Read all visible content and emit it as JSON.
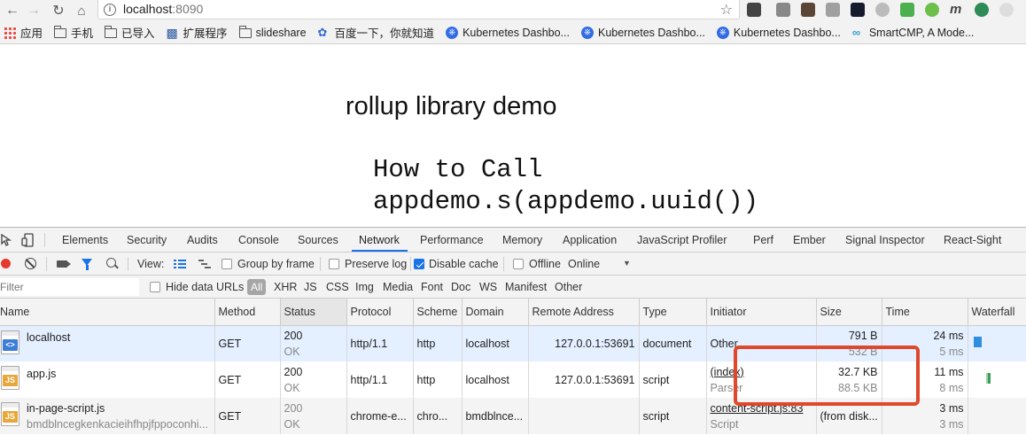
{
  "browser": {
    "url_host": "localhost",
    "url_port": ":8090",
    "bookmarks": [
      {
        "label": "应用",
        "icon": "apps-grid-icon"
      },
      {
        "label": "手机",
        "icon": "folder-icon"
      },
      {
        "label": "已导入",
        "icon": "folder-icon"
      },
      {
        "label": "扩展程序",
        "icon": "puzzle-icon"
      },
      {
        "label": "slideshare",
        "icon": "folder-icon"
      },
      {
        "label": "百度一下，你就知道",
        "icon": "baidu-paw-icon"
      },
      {
        "label": "Kubernetes Dashbo...",
        "icon": "kubernetes-icon"
      },
      {
        "label": "Kubernetes Dashbo...",
        "icon": "kubernetes-icon"
      },
      {
        "label": "Kubernetes Dashbo...",
        "icon": "kubernetes-icon"
      },
      {
        "label": "SmartCMP, A Mode...",
        "icon": "smartcmp-icon"
      }
    ]
  },
  "page": {
    "title": "rollup library demo",
    "code_line1": "How to Call",
    "code_line2": "appdemo.s(appdemo.uuid())"
  },
  "devtools": {
    "tabs": [
      "Elements",
      "Security",
      "Audits",
      "Console",
      "Sources",
      "Network",
      "Performance",
      "Memory",
      "Application",
      "JavaScript Profiler",
      "Perf",
      "Ember",
      "Signal Inspector",
      "React-Sight"
    ],
    "active_tab": "Network",
    "toolbar": {
      "view_label": "View:",
      "group_by_frame": "Group by frame",
      "preserve_log": "Preserve log",
      "disable_cache": "Disable cache",
      "offline": "Offline",
      "throttle": "Online"
    },
    "filter": {
      "placeholder": "Filter",
      "hide_data_urls": "Hide data URLs",
      "types": [
        "All",
        "XHR",
        "JS",
        "CSS",
        "Img",
        "Media",
        "Font",
        "Doc",
        "WS",
        "Manifest",
        "Other"
      ]
    },
    "columns": [
      "Name",
      "Method",
      "Status",
      "Protocol",
      "Scheme",
      "Domain",
      "Remote Address",
      "Type",
      "Initiator",
      "Size",
      "Time",
      "Waterfall"
    ],
    "rows": [
      {
        "name": "localhost",
        "name_sub": "",
        "method": "GET",
        "status": "200",
        "status_text": "OK",
        "protocol": "http/1.1",
        "scheme": "http",
        "domain": "localhost",
        "remote": "127.0.0.1:53691",
        "type": "document",
        "initiator": "Other",
        "initiator_sub": "",
        "size": "791 B",
        "size_sub": "532 B",
        "time": "24 ms",
        "time_sub": "5 ms"
      },
      {
        "name": "app.js",
        "name_sub": "",
        "method": "GET",
        "status": "200",
        "status_text": "OK",
        "protocol": "http/1.1",
        "scheme": "http",
        "domain": "localhost",
        "remote": "127.0.0.1:53691",
        "type": "script",
        "initiator": "(index)",
        "initiator_sub": "Parser",
        "size": "32.7 KB",
        "size_sub": "88.5 KB",
        "time": "11 ms",
        "time_sub": "8 ms"
      },
      {
        "name": "in-page-script.js",
        "name_sub": "bmdblncegkenkacieihfhpjfppoconhi...",
        "method": "GET",
        "status": "200",
        "status_text": "OK",
        "protocol": "chrome-e...",
        "scheme": "chro...",
        "domain": "bmdblnce...",
        "remote": "",
        "type": "script",
        "initiator": "content-script.js:83",
        "initiator_sub": "Script",
        "size": "(from disk...",
        "size_sub": "",
        "time": "3 ms",
        "time_sub": "3 ms"
      }
    ]
  },
  "colors": {
    "accent": "#1a73e8",
    "record": "#e63a2e",
    "annotation": "#e0482c",
    "selected_row": "#e4efff"
  }
}
